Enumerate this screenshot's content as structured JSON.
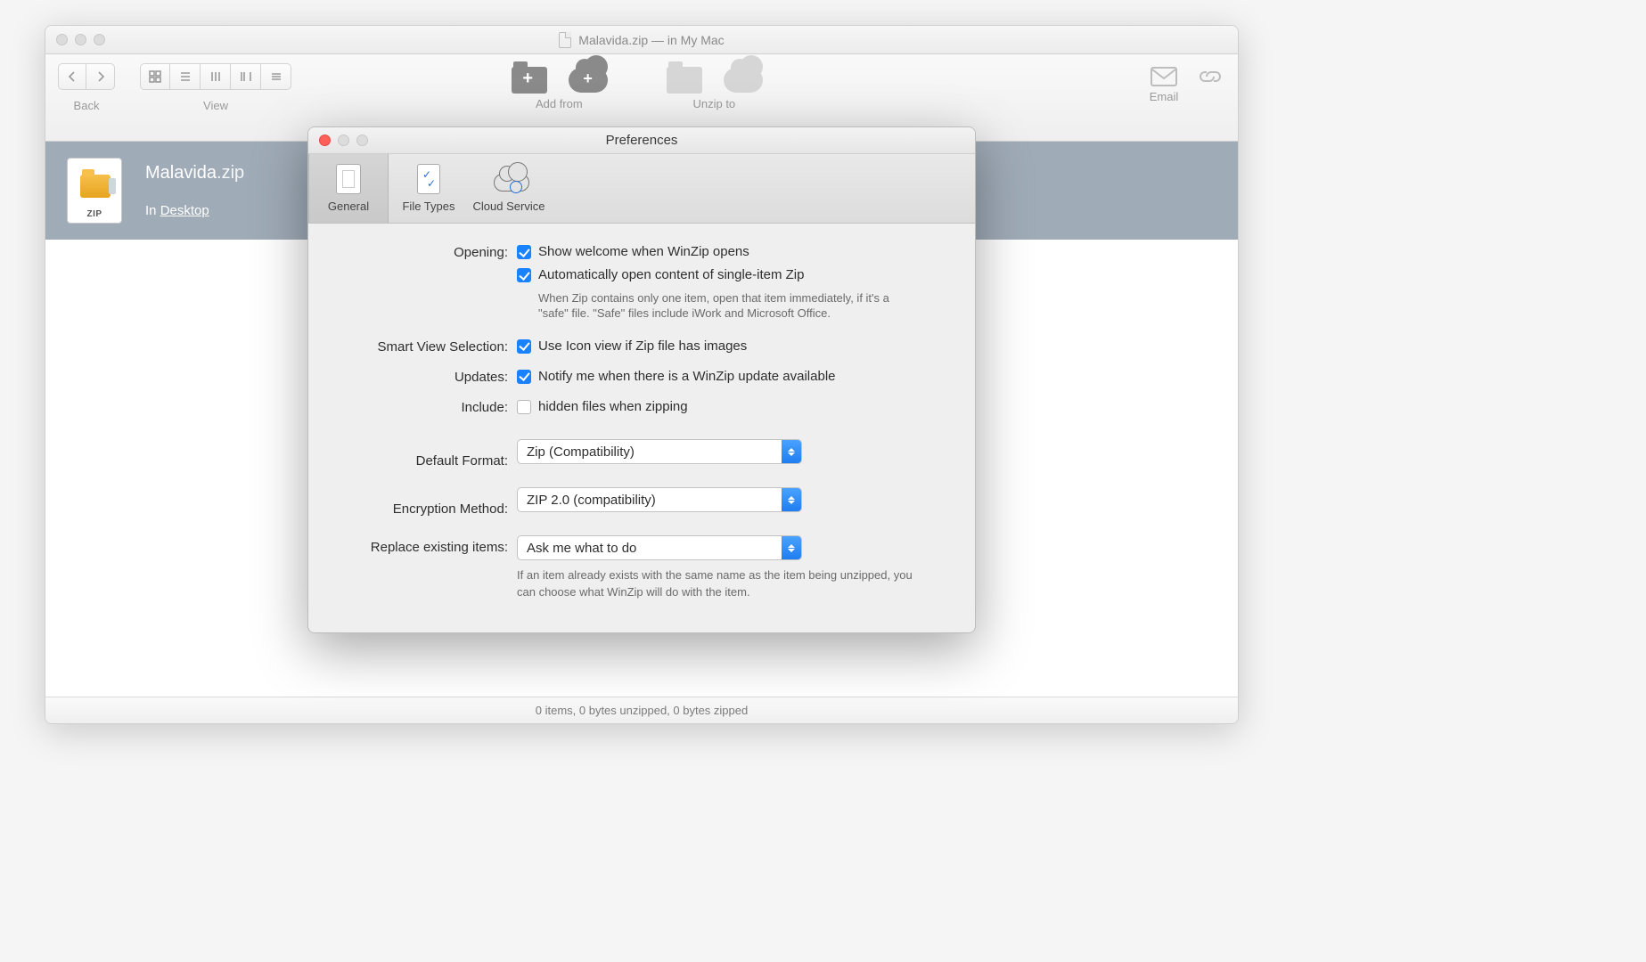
{
  "mainWindow": {
    "title": "Malavida.zip — in My Mac",
    "toolbar": {
      "back_label": "Back",
      "view_label": "View",
      "addfrom_label": "Add from",
      "unzipto_label": "Unzip to",
      "email_label": "Email"
    },
    "fileRow": {
      "name": "Malavida",
      "ext": ".zip",
      "zip_badge": "ZIP",
      "in_prefix": "In ",
      "location": "Desktop"
    },
    "status": "0 items, 0 bytes unzipped, 0 bytes zipped"
  },
  "prefs": {
    "title": "Preferences",
    "tabs": {
      "general": "General",
      "filetypes": "File Types",
      "cloud": "Cloud Service"
    },
    "labels": {
      "opening": "Opening:",
      "smartview": "Smart View Selection:",
      "updates": "Updates:",
      "include": "Include:",
      "default_format": "Default Format:",
      "encryption": "Encryption Method:",
      "replace": "Replace existing items:"
    },
    "opening": {
      "show_welcome": "Show welcome when WinZip opens",
      "auto_open": "Automatically open content of single-item Zip",
      "auto_open_desc": "When Zip contains only one item, open that item immediately, if it's a \"safe\" file. \"Safe\" files include iWork and Microsoft Office."
    },
    "smartview": {
      "use_icon": "Use Icon view if Zip file has images"
    },
    "updates": {
      "notify": "Notify me when there is a WinZip update available"
    },
    "include": {
      "hidden": "hidden files when zipping"
    },
    "defaultFormat": {
      "selected": "Zip (Compatibility)"
    },
    "encryption": {
      "selected": "ZIP 2.0 (compatibility)"
    },
    "replace": {
      "selected": "Ask me what to do",
      "desc": "If an item already exists with the same name as the item being unzipped, you can choose what WinZip will do with the item."
    }
  }
}
